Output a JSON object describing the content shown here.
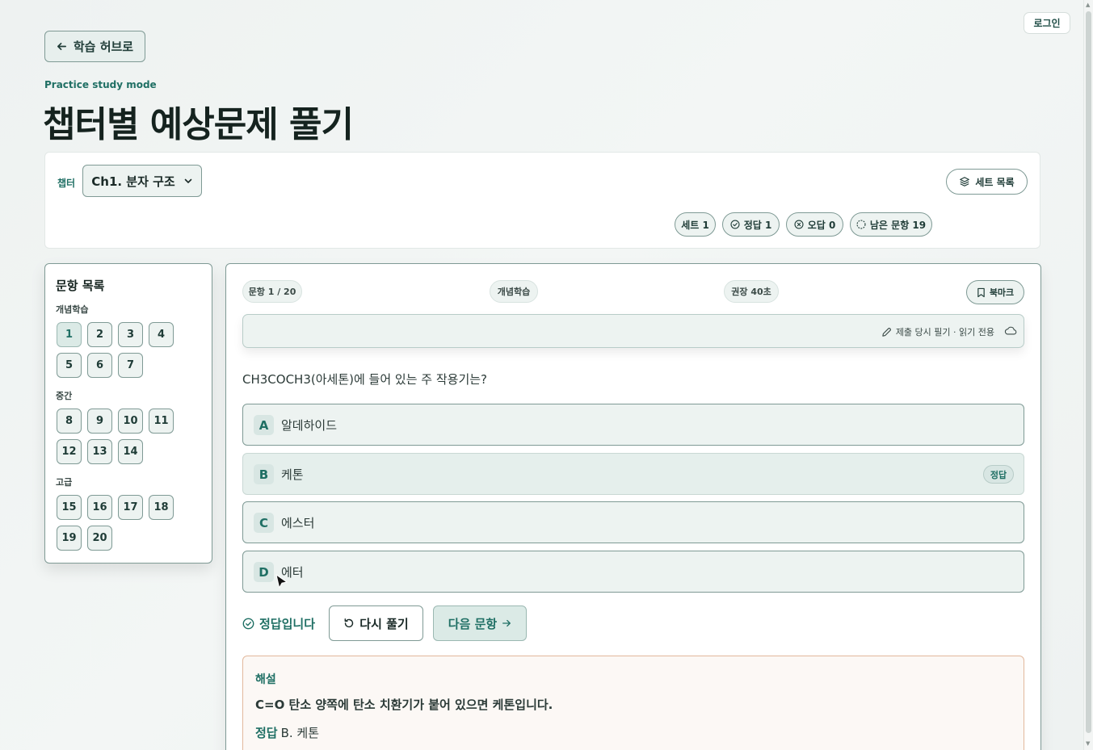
{
  "header": {
    "login_label": "로그인",
    "back_label": "학습 허브로",
    "subtitle": "Practice study mode",
    "title": "챕터별 예상문제 풀기"
  },
  "filter": {
    "chapter_label": "챕터",
    "chapter_value": "Ch1. 분자 구조",
    "set_list_label": "세트 목록",
    "pills": {
      "set": "세트 1",
      "correct": "정답 1",
      "wrong": "오답 0",
      "remaining": "남은 문항 19"
    }
  },
  "sidebar": {
    "title": "문항 목록",
    "groups": [
      {
        "label": "개념학습",
        "items": [
          "1",
          "2",
          "3",
          "4",
          "5",
          "6",
          "7"
        ]
      },
      {
        "label": "중간",
        "items": [
          "8",
          "9",
          "10",
          "11",
          "12",
          "13",
          "14"
        ]
      },
      {
        "label": "고급",
        "items": [
          "15",
          "16",
          "17",
          "18",
          "19",
          "20"
        ]
      }
    ],
    "active_item": "1"
  },
  "main": {
    "progress": "문항 1 / 20",
    "level": "개념학습",
    "recommended_time": "권장 40초",
    "bookmark_label": "북마크",
    "notes_text": "제출 당시 필기 · 읽기 전용",
    "question": "CH3COCH3(아세톤)에 들어 있는 주 작용기는?",
    "options": [
      {
        "letter": "A",
        "text": "알데하이드"
      },
      {
        "letter": "B",
        "text": "케톤",
        "badge": "정답"
      },
      {
        "letter": "C",
        "text": "에스터"
      },
      {
        "letter": "D",
        "text": "에터"
      }
    ],
    "result_text": "정답입니다",
    "retry_label": "다시 풀기",
    "next_label": "다음 문항",
    "explanation": {
      "title": "해설",
      "body": "C=O 탄소 양쪽에 탄소 치환기가 붙어 있으면 케톤입니다.",
      "answer_label": "정답",
      "answer_value": "B. 케톤"
    }
  },
  "colors": {
    "accent": "#1f6f64",
    "border": "#7f9a95",
    "surface": "#edf3f1",
    "explain_border": "#e2b89c"
  }
}
